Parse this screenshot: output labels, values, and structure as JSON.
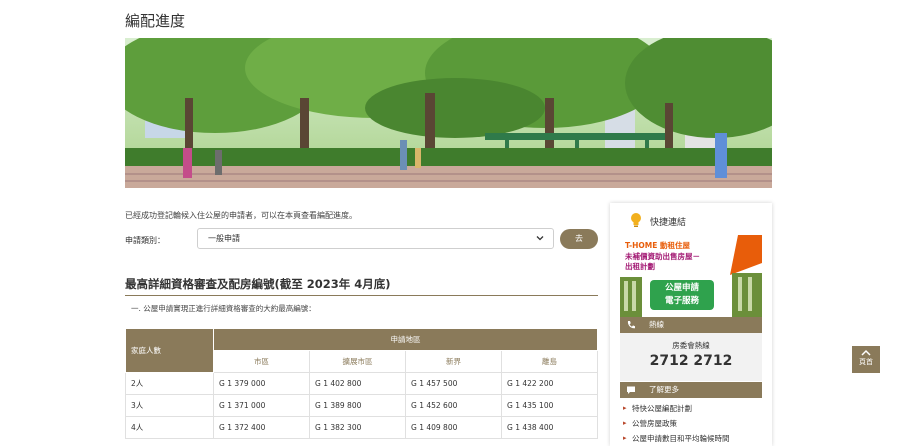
{
  "page": {
    "title": "編配進度"
  },
  "banner": {
    "alt": ""
  },
  "intro": {
    "text": "已經成功登記輪候入住公屋的申請者，可以在本頁查看編配進度。"
  },
  "search": {
    "type_label": "申請類別：",
    "type_value": "一般申請",
    "go_label": "去"
  },
  "section": {
    "heading": "最高詳細資格審查及配房編號(截至 2023年 4月底)",
    "note": "一. 公屋申請實現正進行詳細資格審查的大約最高編號："
  },
  "table": {
    "family_header": "家庭人數",
    "district_group_header": "申請地區",
    "districts": [
      "市區",
      "擴展市區",
      "新界",
      "離島"
    ],
    "rows": [
      {
        "size": "2人",
        "values": [
          "G 1 379 000",
          "G 1 402 800",
          "G 1 457 500",
          "G 1 422 200"
        ]
      },
      {
        "size": "3人",
        "values": [
          "G 1 371 000",
          "G 1 389 800",
          "G 1 452 600",
          "G 1 435 100"
        ]
      },
      {
        "size": "4人",
        "values": [
          "G 1 372 400",
          "G 1 382 300",
          "G 1 409 800",
          "G 1 438 400"
        ]
      }
    ]
  },
  "sidebar": {
    "title": "快捷連結",
    "promo": {
      "line1": "T-HOME 動租住屋",
      "line2": "未補價資助出售房屋－",
      "line3": "出租計劃",
      "badge_line1": "公屋申請",
      "badge_line2": "電子服務"
    },
    "hotline_bar": "熱線",
    "hotline_label": "房委會熱線",
    "hotline_number": "2712 2712",
    "more_bar": "了解更多",
    "links": [
      "特快公屋編配計劃",
      "公營房屋政策",
      "公屋申請數目和平均輪候時間"
    ]
  },
  "back_to_top": {
    "label": "頁首"
  },
  "colors": {
    "accent": "#8a7a5a",
    "promo_green": "#2fa24d",
    "promo_orange": "#e85d0a",
    "promo_purple": "#a31a74"
  }
}
